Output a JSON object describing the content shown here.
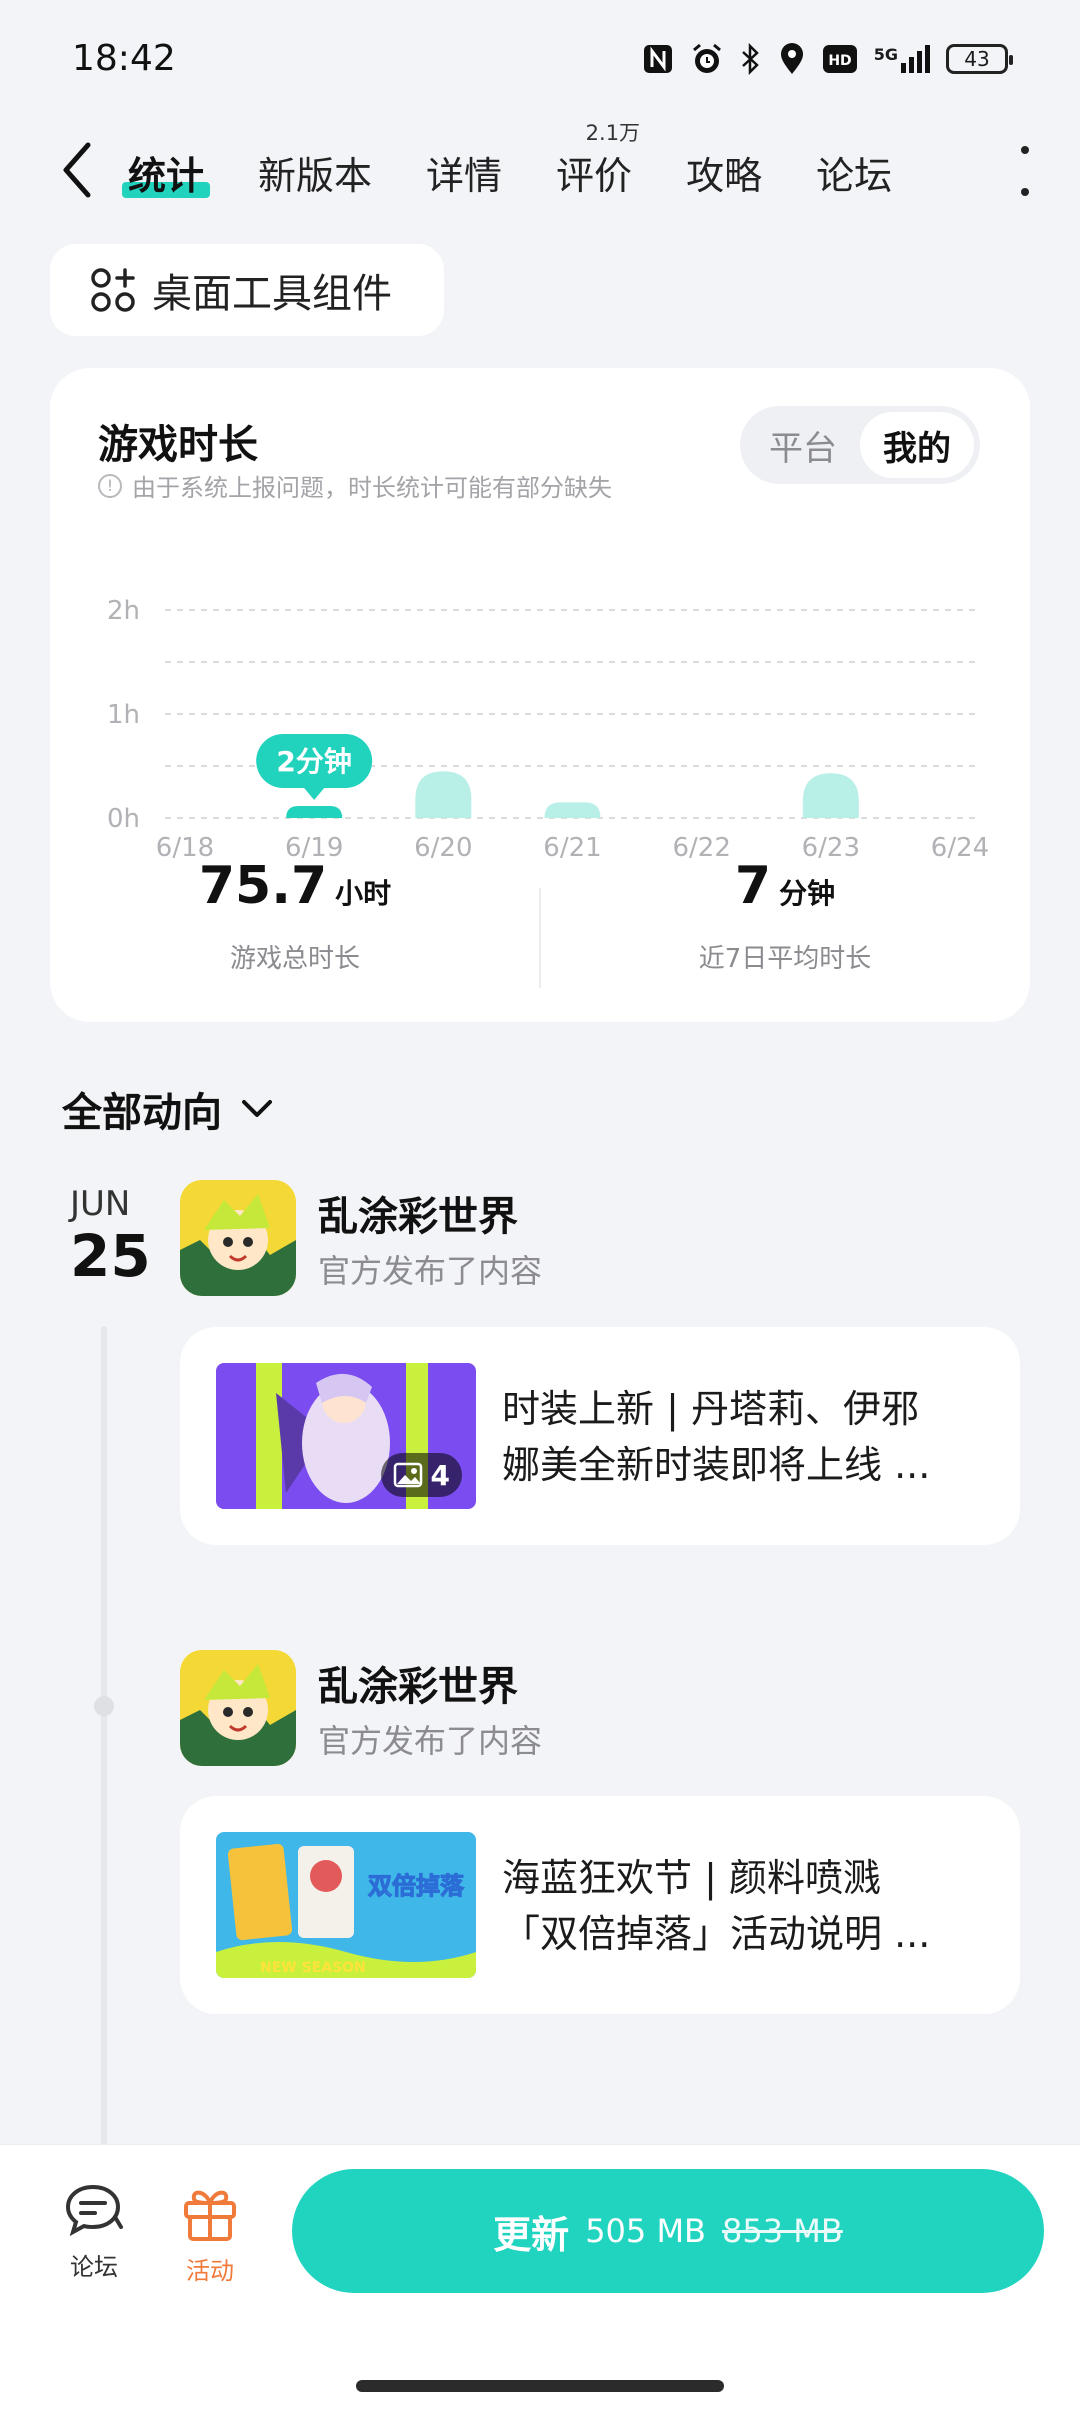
{
  "status_bar": {
    "time": "18:42",
    "network": "5G",
    "battery": "43",
    "icons": [
      "nfc-icon",
      "alarm-icon",
      "bluetooth-icon",
      "location-icon",
      "hd-icon",
      "signal-icon",
      "battery-icon"
    ]
  },
  "tabs": {
    "items": [
      {
        "label": "统计",
        "active": true
      },
      {
        "label": "新版本"
      },
      {
        "label": "详情"
      },
      {
        "label": "评价",
        "badge": "2.1万"
      },
      {
        "label": "攻略"
      },
      {
        "label": "论坛"
      }
    ]
  },
  "widget": {
    "label": "桌面工具组件"
  },
  "stats": {
    "title": "游戏时长",
    "note": "由于系统上报问题，时长统计可能有部分缺失",
    "toggle": {
      "options": [
        "平台",
        "我的"
      ],
      "selected": "我的"
    },
    "total_value": "75.7",
    "total_unit": "小时",
    "total_label": "游戏总时长",
    "avg_value": "7",
    "avg_unit": "分钟",
    "avg_label": "近7日平均时长",
    "accent": "#21d2bd"
  },
  "chart_data": {
    "type": "bar",
    "categories": [
      "6/18",
      "6/19",
      "6/20",
      "6/21",
      "6/22",
      "6/23",
      "6/24"
    ],
    "values": [
      0,
      0.033,
      0.45,
      0.15,
      0,
      0.43,
      0
    ],
    "unit": "h",
    "yticks": [
      "0h",
      "1h",
      "2h"
    ],
    "ylim": [
      0,
      2
    ],
    "grid": true,
    "tooltip": {
      "category": "6/19",
      "label": "2分钟"
    }
  },
  "feed": {
    "header": "全部动向",
    "date": {
      "month": "JUN",
      "day": "25"
    },
    "posts": [
      {
        "app_name": "乱涂彩世界",
        "subtitle": "官方发布了内容",
        "title_line1": "时装上新 | 丹塔莉、伊邪",
        "title_line2": "娜美全新时装即将上线 ...",
        "image_count": "4"
      },
      {
        "app_name": "乱涂彩世界",
        "subtitle": "官方发布了内容",
        "title_line1": "海蓝狂欢节 | 颜料喷溅",
        "title_line2": "「双倍掉落」活动说明 ...",
        "thumb_text": "双倍掉落",
        "thumb_sub": "NEW SEASON"
      }
    ]
  },
  "bottom": {
    "forum_label": "论坛",
    "activity_label": "活动",
    "activity_color": "#f07a3a",
    "update_main": "更新",
    "update_size": "505 MB",
    "update_old_size": "853 MB",
    "update_color": "#21d4c0"
  }
}
